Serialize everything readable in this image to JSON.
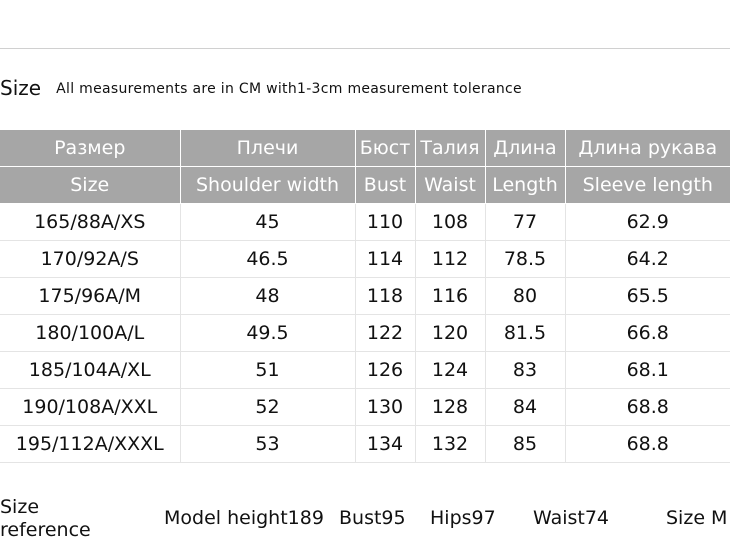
{
  "heading": {
    "title": "Size",
    "note": "All measurements are in CM with1-3cm measurement tolerance"
  },
  "table": {
    "header_ru": [
      "Размер",
      "Плечи",
      "Бюст",
      "Талия",
      "Длина",
      "Длина рукава"
    ],
    "header_en": [
      "Size",
      "Shoulder width",
      "Bust",
      "Waist",
      "Length",
      "Sleeve length"
    ],
    "rows": [
      [
        "165/88A/XS",
        "45",
        "110",
        "108",
        "77",
        "62.9"
      ],
      [
        "170/92A/S",
        "46.5",
        "114",
        "112",
        "78.5",
        "64.2"
      ],
      [
        "175/96A/M",
        "48",
        "118",
        "116",
        "80",
        "65.5"
      ],
      [
        "180/100A/L",
        "49.5",
        "122",
        "120",
        "81.5",
        "66.8"
      ],
      [
        "185/104A/XL",
        "51",
        "126",
        "124",
        "83",
        "68.1"
      ],
      [
        "190/108A/XXL",
        "52",
        "130",
        "128",
        "84",
        "68.8"
      ],
      [
        "195/112A/XXXL",
        "53",
        "134",
        "132",
        "85",
        "68.8"
      ]
    ]
  },
  "reference": {
    "label": "Size reference",
    "model_height": "Model height189",
    "bust": "Bust95",
    "hips": "Hips97",
    "waist": "Waist74",
    "size": "Size M"
  },
  "colors": {
    "header_bg": "#a6a6a6",
    "header_text": "#ffffff",
    "grid_line": "#e4e4e4"
  }
}
